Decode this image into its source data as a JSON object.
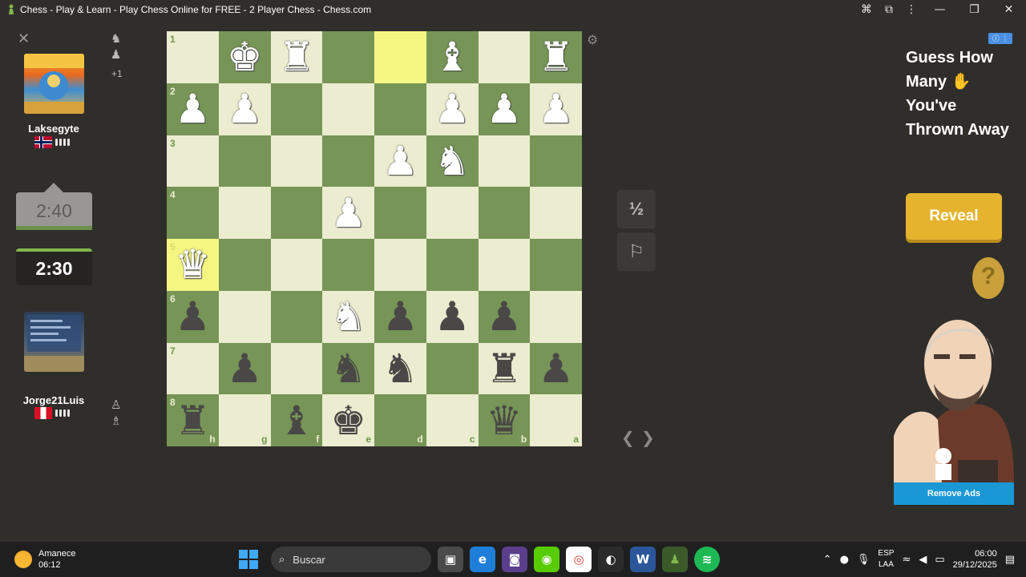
{
  "window": {
    "title": "Chess - Play & Learn - Play Chess Online for FREE - 2 Player Chess - Chess.com"
  },
  "players": {
    "top": {
      "name": "Laksegyte",
      "clock": "2:40",
      "captured_extra": "+1"
    },
    "bottom": {
      "name": "Jorge21Luis",
      "clock": "2:30"
    }
  },
  "board": {
    "ranks": [
      "1",
      "2",
      "3",
      "4",
      "5",
      "6",
      "7",
      "8"
    ],
    "files": [
      "h",
      "g",
      "f",
      "e",
      "d",
      "c",
      "b",
      "a"
    ],
    "highlighted_squares": [
      "d1",
      "h5"
    ],
    "rows": [
      [
        "",
        "wK",
        "wR",
        "",
        "",
        "wB",
        "",
        "wR"
      ],
      [
        "wP",
        "wP",
        "",
        "",
        "",
        "wP",
        "wP",
        "wP"
      ],
      [
        "",
        "",
        "",
        "",
        "wP",
        "wN",
        "",
        ""
      ],
      [
        "",
        "",
        "",
        "wP",
        "",
        "",
        "",
        ""
      ],
      [
        "wQ",
        "",
        "",
        "",
        "",
        "",
        "",
        ""
      ],
      [
        "bP",
        "",
        "",
        "wN",
        "bP",
        "bP",
        "bP",
        ""
      ],
      [
        "",
        "bP",
        "",
        "bN",
        "bN",
        "",
        "bR",
        "bP"
      ],
      [
        "bR",
        "",
        "bB",
        "bK",
        "",
        "",
        "bQ",
        ""
      ]
    ]
  },
  "controls": {
    "draw_label": "½",
    "resign_icon": "flag-icon",
    "settings_icon": "gear-icon"
  },
  "ad": {
    "headline": "Guess How Many ✋ You've Thrown Away",
    "cta": "Reveal",
    "remove_ads": "Remove Ads",
    "badge": "ⓘ ⋮"
  },
  "taskbar": {
    "weather_label": "Amanece",
    "weather_time": "06:12",
    "search_placeholder": "Buscar",
    "lang_top": "ESP",
    "lang_bottom": "LAA",
    "time": "06:00",
    "date": "29/12/2025"
  }
}
